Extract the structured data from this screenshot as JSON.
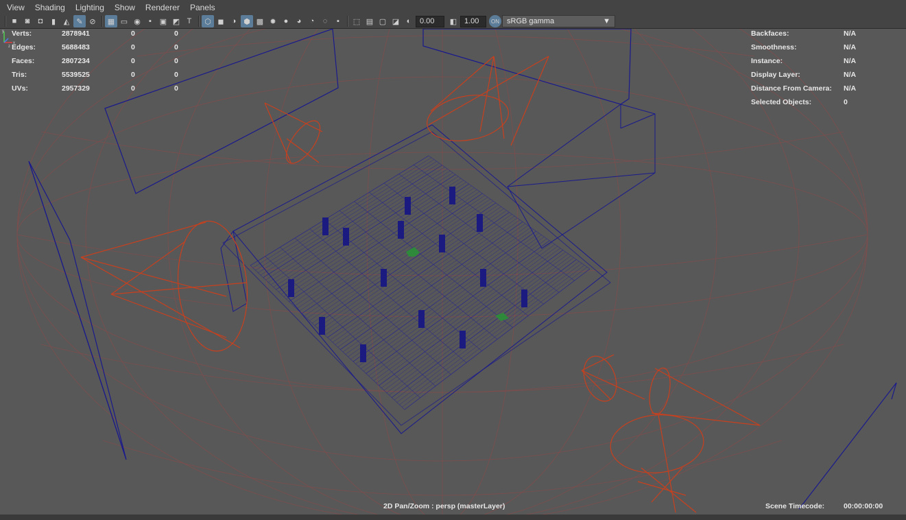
{
  "menubar": {
    "items": [
      "View",
      "Shading",
      "Lighting",
      "Show",
      "Renderer",
      "Panels"
    ]
  },
  "toolbar": {
    "exposure_value": "0.00",
    "gamma_value": "1.00",
    "color_space": "sRGB gamma",
    "icons": [
      "camera-icon",
      "camera-attr-icon",
      "camera-lock-icon",
      "bookmark-icon",
      "image-plane-icon",
      "grease-pencil-icon",
      "2d-pan-zoom-icon",
      "grid-icon",
      "film-gate-icon",
      "resolution-gate-icon",
      "gate-mask-icon",
      "field-chart-icon",
      "safe-action-icon",
      "title-safe-icon",
      "wireframe-icon",
      "smooth-shade-icon",
      "default-material-icon",
      "textured-icon",
      "use-all-lights-icon",
      "shadows-icon",
      "ambient-occlusion-icon",
      "motion-blur-icon",
      "anti-aliasing-icon",
      "depth-of-field-icon",
      "isolate-select-icon",
      "xray-icon",
      "xray-joints-icon",
      "backface-culling-icon",
      "exposure-icon",
      "gamma-icon",
      "color-management-icon"
    ]
  },
  "hud_left": {
    "rows": [
      {
        "label": "Verts:",
        "v1": "2878941",
        "v2": "0",
        "v3": "0"
      },
      {
        "label": "Edges:",
        "v1": "5688483",
        "v2": "0",
        "v3": "0"
      },
      {
        "label": "Faces:",
        "v1": "2807234",
        "v2": "0",
        "v3": "0"
      },
      {
        "label": "Tris:",
        "v1": "5539525",
        "v2": "0",
        "v3": "0"
      },
      {
        "label": "UVs:",
        "v1": "2957329",
        "v2": "0",
        "v3": "0"
      }
    ]
  },
  "hud_right": {
    "rows": [
      {
        "label": "Backfaces:",
        "value": "N/A"
      },
      {
        "label": "Smoothness:",
        "value": "N/A"
      },
      {
        "label": "Instance:",
        "value": "N/A"
      },
      {
        "label": "Display Layer:",
        "value": "N/A"
      },
      {
        "label": "Distance From Camera:",
        "value": "N/A"
      },
      {
        "label": "Selected Objects:",
        "value": "0"
      }
    ]
  },
  "hud_bottom": {
    "camera_label": "2D Pan/Zoom : persp (masterLayer)",
    "timecode_label": "Scene Timecode:",
    "timecode_value": "00:00:00:00"
  },
  "axis": {
    "x": "x",
    "y": "y",
    "z": "z"
  },
  "colors": {
    "wire_blue": "#1a1a8c",
    "light_red": "#c8401e",
    "grid_red": "#8a4a4a",
    "viewport_bg": "#585858"
  }
}
